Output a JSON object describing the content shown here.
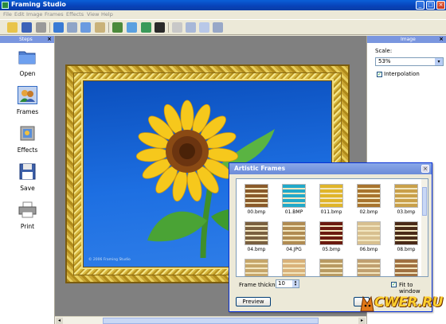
{
  "window": {
    "title": "Framing Studio"
  },
  "menu": [
    "File",
    "Edit",
    "Image",
    "Frames",
    "Effects",
    "View",
    "Help"
  ],
  "steps_panel": {
    "title": "Steps",
    "items": [
      {
        "label": "Open",
        "icon": "folder-icon"
      },
      {
        "label": "Frames",
        "icon": "frames-icon"
      },
      {
        "label": "Effects",
        "icon": "effects-icon"
      },
      {
        "label": "Save",
        "icon": "floppy-icon"
      },
      {
        "label": "Print",
        "icon": "printer-icon"
      }
    ],
    "selected": "Frames"
  },
  "image_panel": {
    "title": "Image",
    "scale_label": "Scale:",
    "scale_value": "53%",
    "interpolation_label": "Interpolation",
    "interpolation_checked": true
  },
  "canvas": {
    "copyright": "© 2006 Framing Studio"
  },
  "artistic_frames": {
    "title": "Artistic Frames",
    "items": [
      {
        "name": "00.bmp",
        "color": "#8a5a2a"
      },
      {
        "name": "01.BMP",
        "color": "#22a9c9"
      },
      {
        "name": "011.bmp",
        "color": "#e0b52a"
      },
      {
        "name": "02.bmp",
        "color": "#a8742e"
      },
      {
        "name": "03.bmp",
        "color": "#c9a04a"
      },
      {
        "name": "04.bmp",
        "color": "#7a6040"
      },
      {
        "name": "04.JPG",
        "color": "#b08b52"
      },
      {
        "name": "05.bmp",
        "color": "#6b1a10"
      },
      {
        "name": "06.bmp",
        "color": "#d8c090"
      },
      {
        "name": "08.bmp",
        "color": "#4a2a18"
      },
      {
        "name": "",
        "color": "#c6a66a"
      },
      {
        "name": "",
        "color": "#d9b27a"
      },
      {
        "name": "",
        "color": "#b89a62"
      },
      {
        "name": "",
        "color": "#c0a070"
      },
      {
        "name": "",
        "color": "#a07040"
      }
    ],
    "frame_thickness_label": "Frame thickness",
    "frame_thickness_value": "10",
    "fit_to_window_label": "Fit to window",
    "fit_to_window_checked": true,
    "preview_label": "Preview"
  },
  "watermark": {
    "text": "CWER.RU"
  },
  "colors": {
    "titlebar": "#0842b8",
    "panel_header": "#7a96df",
    "frame_gold": "#d6b73e",
    "sky": "#1d6fe2"
  }
}
